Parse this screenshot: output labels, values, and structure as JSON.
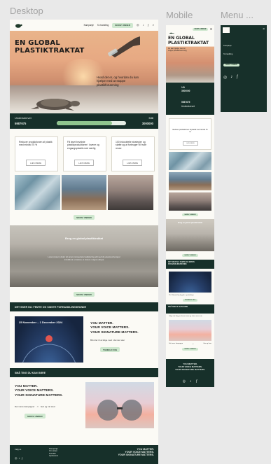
{
  "frames": {
    "desktop_label": "Desktop",
    "mobile_label": "Mobile",
    "menu_label": "Menu ..."
  },
  "colors": {
    "dark": "#17302a",
    "accent": "#cfe8cf",
    "progress": "#8fc48d",
    "paper": "#fbfaf5"
  },
  "desktop": {
    "nav": {
      "link1": "Kampanje",
      "link2": "Ta handling",
      "cta": "SKRIV UNDER",
      "icons": [
        "instagram-icon",
        "tiktok-icon",
        "facebook-icon",
        "search-icon"
      ]
    },
    "hero": {
      "title": "EN GLOBAL PLASTIKTRAKTAT",
      "subtitle": "Hvad det er, og hvordan du kan hjælpe med at stoppe plastikforurening"
    },
    "counter": {
      "signed_label": "Underskrevet",
      "goal_label": "Mål",
      "signed_value": "5987675",
      "goal_value": "3000000",
      "progress": 0.8
    },
    "cards": [
      {
        "text": "Reducer produktionen af plastik med mindst 75 %",
        "button": "LÆS MERE"
      },
      {
        "text": "Få lavet bevidste plastikproduktioner i lovene og engangsplastik med særlig",
        "button": "LÆS MERE"
      },
      {
        "text": "100 industrielle strategier og støtte og at forbruger vil hvde reuse",
        "button": "LÆS MERE"
      }
    ],
    "cta_after_photos": "SKRIV UNDER",
    "beach": {
      "title": "Brug en global plastiktraktat",
      "text": "Lorem ipsum dolor sit amet consectetur adipiscing elit sed do eiusmod tempor incididunt ut labore et dolore magna aliqua"
    },
    "cta_after_beach": "SKRIV UNDER",
    "events": {
      "heading": "DET SKER NU: FEMTE OG SIDSTE FORHANDLINGSRUNDE",
      "date": "25 November – 1 December 2024",
      "slogan": [
        "YOU MATTER.",
        "YOUR VOICE MATTERS.",
        "YOUR SIGNATURE MATTERS."
      ],
      "note": "Bliv klar til at følge med i det der sker",
      "button": "TILMELD DIG"
    },
    "what_you_can_do": {
      "heading": "SMÅ TING DU KAN GØRE",
      "slogan": [
        "YOU MATTER.",
        "YOUR VOICE MATTERS.",
        "YOUR SIGNATURE MATTERS."
      ],
      "share": "Del vores kampagne!",
      "share2": "Gør og mit sted",
      "button": "SKRIV UNDER"
    },
    "footer": {
      "left": "Følg os",
      "links": [
        "Kampanje",
        "Om siden",
        "Kontakt",
        "Ophavsret"
      ],
      "slogan": [
        "YOU MATTER.",
        "YOUR VOICE MATTERS.",
        "YOUR SIGNATURE MATTERS."
      ]
    }
  },
  "mobile": {
    "cta": "SKRIV UNDER",
    "hero_title": "EN GLOBAL PLASTIKTRAKTAT",
    "hero_sub": "Du kan hjælpe med at stoppe plastikforurening",
    "goal_label": "Mål",
    "goal_value": "3000000",
    "signed_value": "5987675",
    "signed_label": "Underskrevet",
    "card_text": "Reducer produktionen af plastik med mindst 75 %",
    "card_button": "LÆS MERE",
    "beach_title": "Brug en global plastiktraktat",
    "events_heading": "DET SKER NU: FEMTE OG SIDSTE FORHANDLINGSRUNDE",
    "events_caption": "25-1 Nøvele Fg dig plm. og lindstingi",
    "events_button": "TILMELD DIG",
    "what_heading": "SMÅ TING DU KAN GØRE",
    "what_text": "Udgiv din blog på denne tema og skrive mere om",
    "share": "Del vores kampagne",
    "share2": "Gør og hvor",
    "footer_slogan": [
      "YOU MATTER.",
      "YOUR VOICE MATTERS.",
      "YOUR SIGNATURE MATTERS."
    ]
  },
  "menu": {
    "item1": "Kampanje",
    "item2": "Ta handling",
    "cta": "SKRIV UNDER",
    "close": "×"
  }
}
